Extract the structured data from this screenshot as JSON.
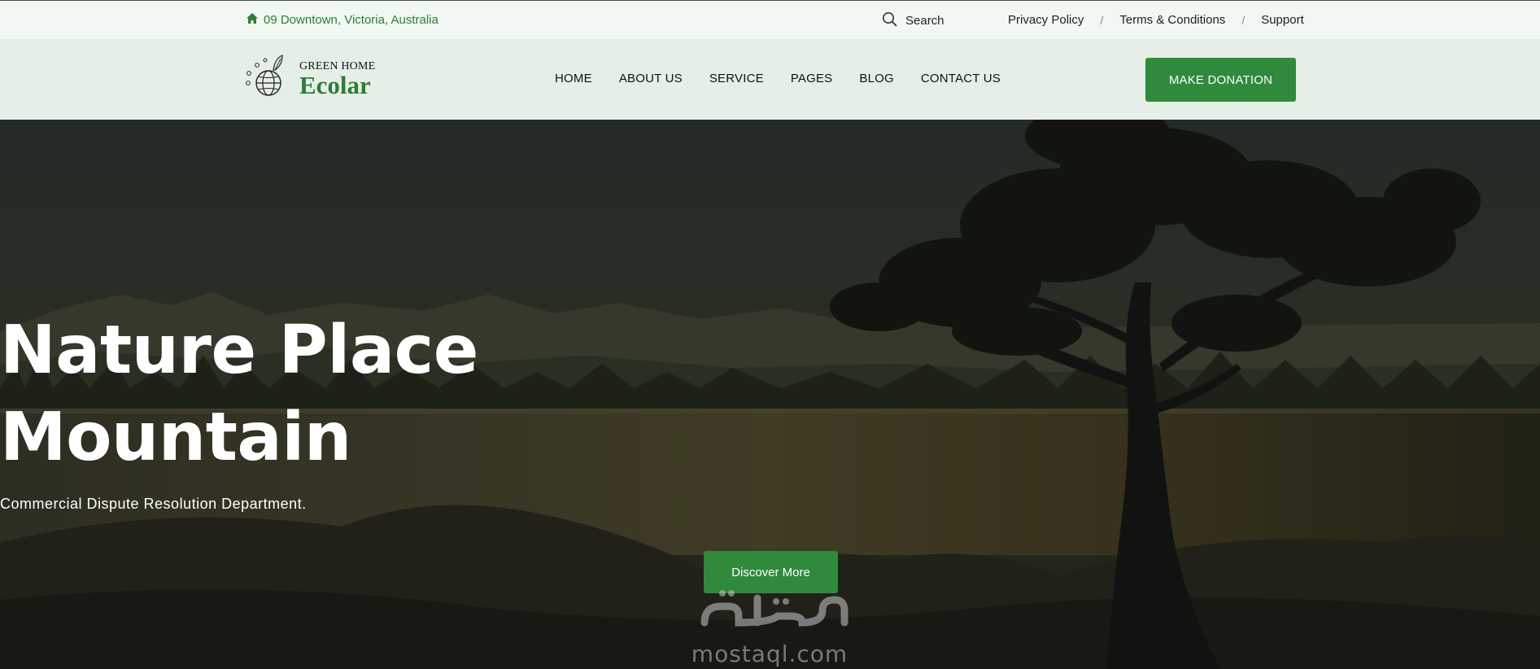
{
  "topbar": {
    "address": "09 Downtown, Victoria, Australia",
    "search_label": "Search",
    "links": [
      "Privacy Policy",
      "Terms & Conditions",
      "Support"
    ],
    "separator": "/"
  },
  "logo": {
    "tagline": "GREEN HOME",
    "brand": "Ecolar"
  },
  "nav": {
    "items": [
      "HOME",
      "ABOUT US",
      "SERVICE",
      "PAGES",
      "BLOG",
      "CONTACT US"
    ]
  },
  "cta": {
    "donate_label": "MAKE DONATION"
  },
  "hero": {
    "title_line1": "Nature Place",
    "title_line2": "Mountain",
    "subtitle": "Commercial Dispute Resolution Department.",
    "button_label": "Discover More"
  },
  "watermark": {
    "text": "mostaql.com"
  },
  "colors": {
    "accent": "#2f8a3b",
    "topbar_bg": "#f1f7f2",
    "header_bg": "#e6efe7"
  }
}
